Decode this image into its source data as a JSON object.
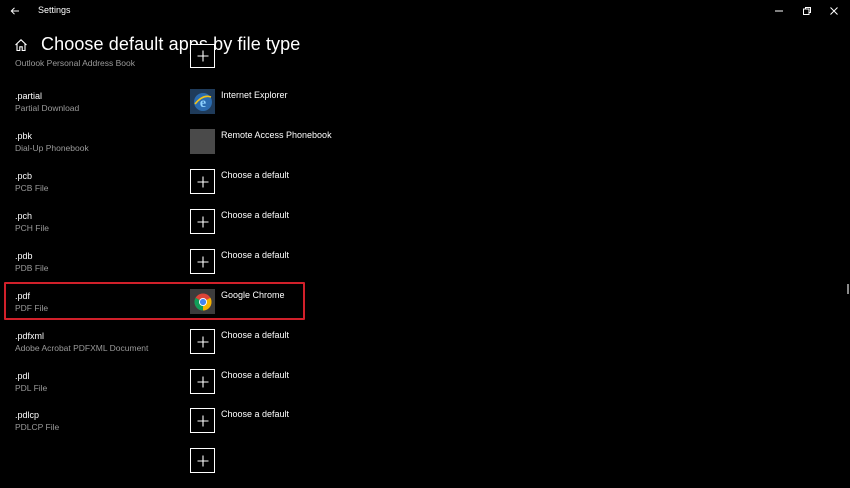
{
  "window": {
    "title": "Settings"
  },
  "header": {
    "title": "Choose default apps by file type"
  },
  "rows": [
    {
      "ext": "",
      "desc": "Outlook Personal Address Book",
      "app": "",
      "icon": "plus-icon"
    },
    {
      "ext": ".partial",
      "desc": "Partial Download",
      "app": "Internet Explorer",
      "icon": "internet-explorer-icon"
    },
    {
      "ext": ".pbk",
      "desc": "Dial-Up Phonebook",
      "app": "Remote Access Phonebook",
      "icon": "phonebook-app-icon"
    },
    {
      "ext": ".pcb",
      "desc": "PCB File",
      "app": "Choose a default",
      "icon": "plus-icon"
    },
    {
      "ext": ".pch",
      "desc": "PCH File",
      "app": "Choose a default",
      "icon": "plus-icon"
    },
    {
      "ext": ".pdb",
      "desc": "PDB File",
      "app": "Choose a default",
      "icon": "plus-icon"
    },
    {
      "ext": ".pdf",
      "desc": "PDF File",
      "app": "Google Chrome",
      "icon": "google-chrome-icon"
    },
    {
      "ext": ".pdfxml",
      "desc": "Adobe Acrobat PDFXML Document",
      "app": "Choose a default",
      "icon": "plus-icon"
    },
    {
      "ext": ".pdl",
      "desc": "PDL File",
      "app": "Choose a default",
      "icon": "plus-icon"
    },
    {
      "ext": ".pdlcp",
      "desc": "PDLCP File",
      "app": "Choose a default",
      "icon": "plus-icon"
    },
    {
      "ext": "",
      "desc": "",
      "app": "",
      "icon": "plus-icon"
    }
  ],
  "colors": {
    "background": "#000000",
    "highlight": "#d1202a",
    "secondary_text": "#9a9a9a"
  }
}
